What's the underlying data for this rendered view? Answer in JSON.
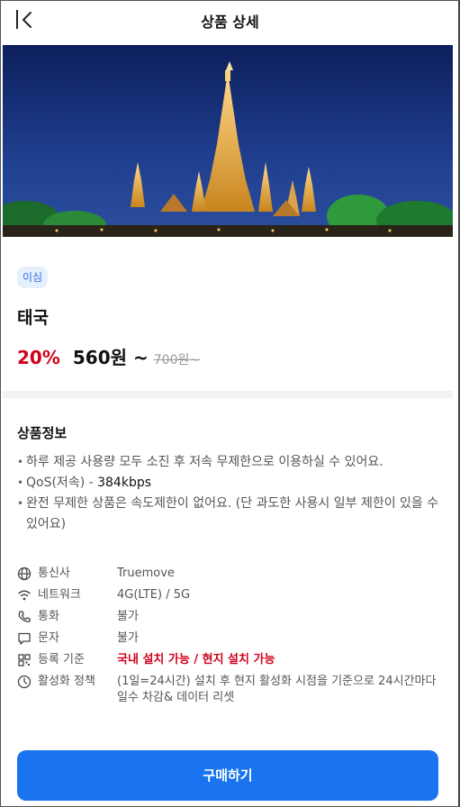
{
  "header": {
    "title": "상품 상세"
  },
  "product": {
    "badge": "이심",
    "name": "태국",
    "discount": "20%",
    "price": "560원 ~",
    "original_price": "700원~"
  },
  "info": {
    "section_title": "상품정보",
    "bullets": [
      "하루 제공 사용량 모두 소진 후 저속 무제한으로 이용하실 수 있어요.",
      "QoS(저속) - ",
      "완전 무제한 상품은 속도제한이 없어요. (단 과도한 사용시 일부 제한이 있을 수 있어요)"
    ],
    "qos_value": "384kbps",
    "specs": [
      {
        "icon": "globe-icon",
        "label": "통신사",
        "value": "Truemove"
      },
      {
        "icon": "wifi-icon",
        "label": "네트워크",
        "value": "4G(LTE) / 5G"
      },
      {
        "icon": "phone-icon",
        "label": "통화",
        "value": "불가"
      },
      {
        "icon": "message-icon",
        "label": "문자",
        "value": "불가"
      },
      {
        "icon": "qr-code-icon",
        "label": "등록 기준",
        "value": "국내 설치 가능 / 현지 설치 가능"
      },
      {
        "icon": "clock-icon",
        "label": "활성화 정책",
        "value": "(1일=24시간) 설치 후 현지 활성화 시점을 기준으로 24시간마다 일수 차감& 데이터 리셋"
      }
    ]
  },
  "actions": {
    "buy_label": "구매하기"
  },
  "colors": {
    "accent": "#1a74f0",
    "discount": "#d0021b",
    "badge_bg": "#e6f0fd",
    "badge_text": "#2a72e6"
  }
}
